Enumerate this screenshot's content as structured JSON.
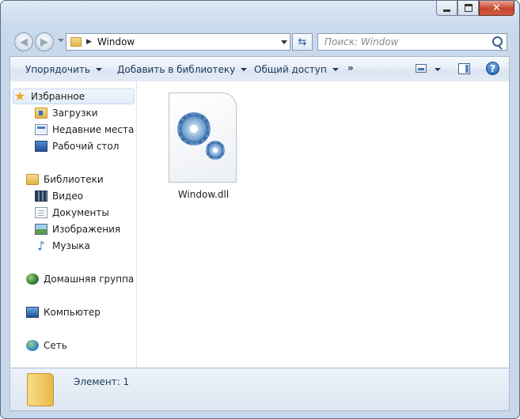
{
  "window": {
    "colors": {
      "frame": "#c9d9ec",
      "close": "#c7462f",
      "accent": "#1e395b"
    }
  },
  "caption": {
    "close_glyph": "✕"
  },
  "address": {
    "crumb": "Window",
    "separator": "▶"
  },
  "search": {
    "placeholder": "Поиск: Window"
  },
  "toolbar": {
    "organize": "Упорядочить",
    "add_to_library": "Добавить в библиотеку",
    "share": "Общий доступ",
    "more": "»",
    "help": "?"
  },
  "navpane": {
    "favorites": {
      "label": "Избранное",
      "icon": "star-icon"
    },
    "favorites_items": [
      {
        "label": "Загрузки",
        "icon": "downloads-folder-icon"
      },
      {
        "label": "Недавние места",
        "icon": "recent-places-icon"
      },
      {
        "label": "Рабочий стол",
        "icon": "desktop-icon"
      }
    ],
    "libraries": {
      "label": "Библиотеки",
      "icon": "libraries-icon"
    },
    "libraries_items": [
      {
        "label": "Видео",
        "icon": "video-icon"
      },
      {
        "label": "Документы",
        "icon": "documents-icon"
      },
      {
        "label": "Изображения",
        "icon": "pictures-icon"
      },
      {
        "label": "Музыка",
        "icon": "music-icon"
      }
    ],
    "homegroup": {
      "label": "Домашняя группа",
      "icon": "homegroup-icon"
    },
    "computer": {
      "label": "Компьютер",
      "icon": "computer-icon"
    },
    "network": {
      "label": "Сеть",
      "icon": "network-icon"
    }
  },
  "files": [
    {
      "name": "Window.dll",
      "icon": "dll-gears-icon"
    }
  ],
  "status": {
    "text": "Элемент: 1"
  }
}
